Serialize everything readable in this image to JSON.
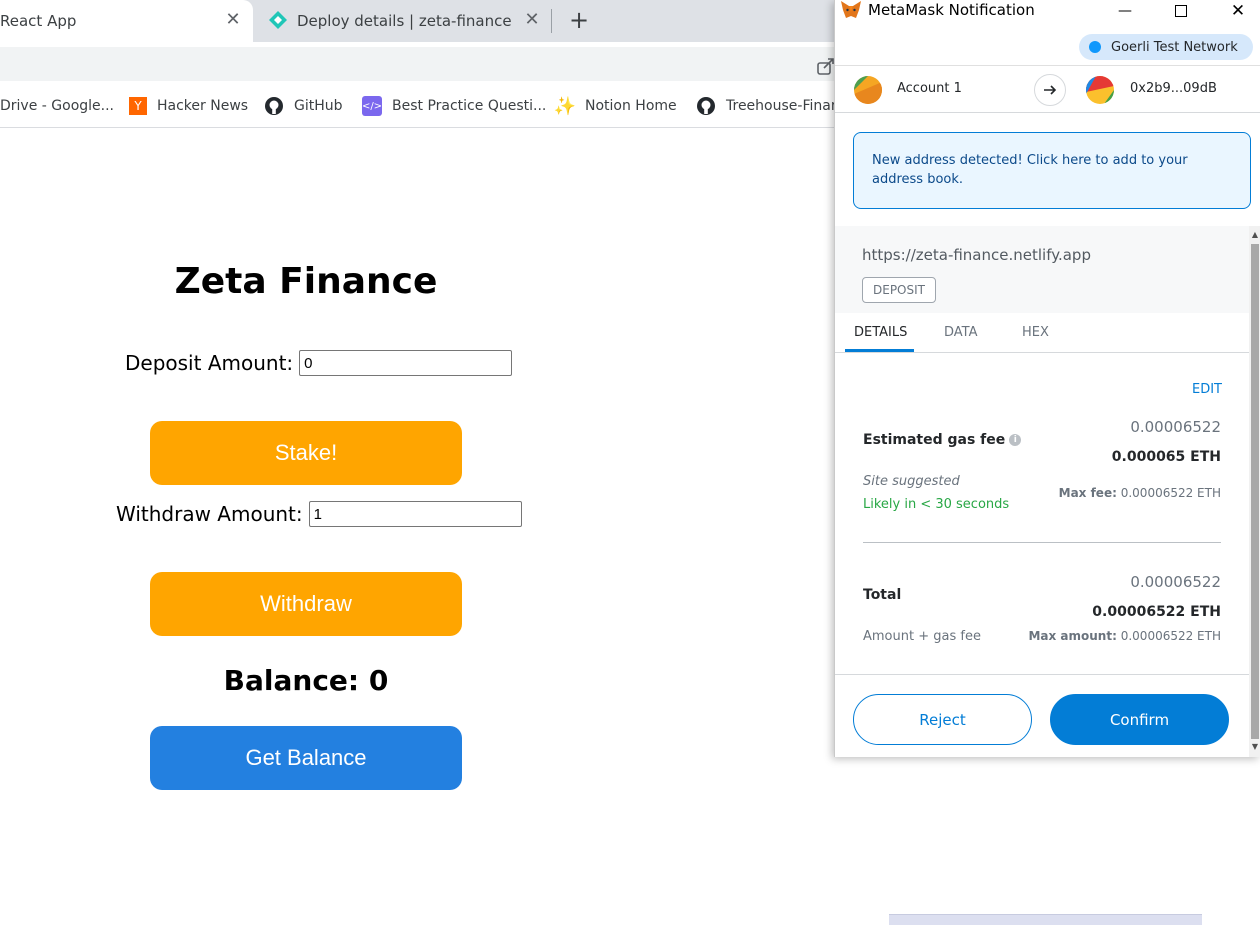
{
  "browser": {
    "tabs": [
      {
        "title": "React App",
        "active": true
      },
      {
        "title": "Deploy details | zeta-finance",
        "active": false
      }
    ],
    "bookmarks": [
      {
        "label": "Drive - Google...",
        "icon": "drive-icon"
      },
      {
        "label": "Hacker News",
        "icon": "hacker-news-icon"
      },
      {
        "label": "GitHub",
        "icon": "github-icon"
      },
      {
        "label": "Best Practice Questi...",
        "icon": "code-icon"
      },
      {
        "label": "Notion Home",
        "icon": "sparkle-icon"
      },
      {
        "label": "Treehouse-Finan",
        "icon": "github-icon"
      }
    ]
  },
  "app": {
    "title": "Zeta Finance",
    "deposit_label": "Deposit Amount:",
    "deposit_value": "0",
    "stake_button": "Stake!",
    "withdraw_label": "Withdraw Amount:",
    "withdraw_value": "1",
    "withdraw_button": "Withdraw",
    "balance_text": "Balance: 0",
    "get_balance_button": "Get Balance",
    "colors": {
      "primary_button": "#ffa500",
      "secondary_button": "#2380e0"
    }
  },
  "metamask": {
    "window_title": "MetaMask Notification",
    "network": "Goerli Test Network",
    "from_account": "Account 1",
    "to_address": "0x2b9...09dB",
    "notice": "New address detected! Click here to add to your address book.",
    "origin": "https://zeta-finance.netlify.app",
    "method": "DEPOSIT",
    "tabs": [
      "DETAILS",
      "DATA",
      "HEX"
    ],
    "edit_label": "EDIT",
    "gas": {
      "label": "Estimated gas fee",
      "fiat_like": "0.00006522",
      "amount": "0.000065 ETH",
      "site_suggested": "Site suggested",
      "likely": "Likely in < 30 seconds",
      "max_fee_label": "Max fee:",
      "max_fee_value": "0.00006522 ETH"
    },
    "total": {
      "label": "Total",
      "fiat_like": "0.00006522",
      "amount": "0.00006522 ETH",
      "sub_label": "Amount + gas fee",
      "max_amount_label": "Max amount:",
      "max_amount_value": "0.00006522 ETH"
    },
    "reject_button": "Reject",
    "confirm_button": "Confirm",
    "colors": {
      "accent": "#037dd6",
      "success": "#28a745"
    }
  }
}
